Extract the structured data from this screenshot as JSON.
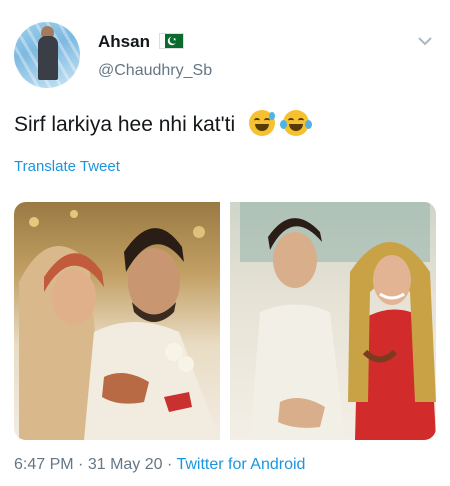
{
  "author": {
    "name": "Ahsan",
    "handle": "@Chaudhry_Sb",
    "flag_icon": "pakistan-flag-icon"
  },
  "tweet": {
    "text": "Sirf larkiya hee nhi kat'ti",
    "emojis": [
      "grinning-sweat-emoji",
      "tears-of-joy-emoji"
    ],
    "translate_label": "Translate Tweet"
  },
  "meta": {
    "time": "6:47 PM",
    "date": "31 May 20",
    "separator": "·",
    "source": "Twitter for Android"
  },
  "colors": {
    "link": "#1b95e0",
    "secondary_text": "#657786",
    "primary_text": "#14171a"
  }
}
